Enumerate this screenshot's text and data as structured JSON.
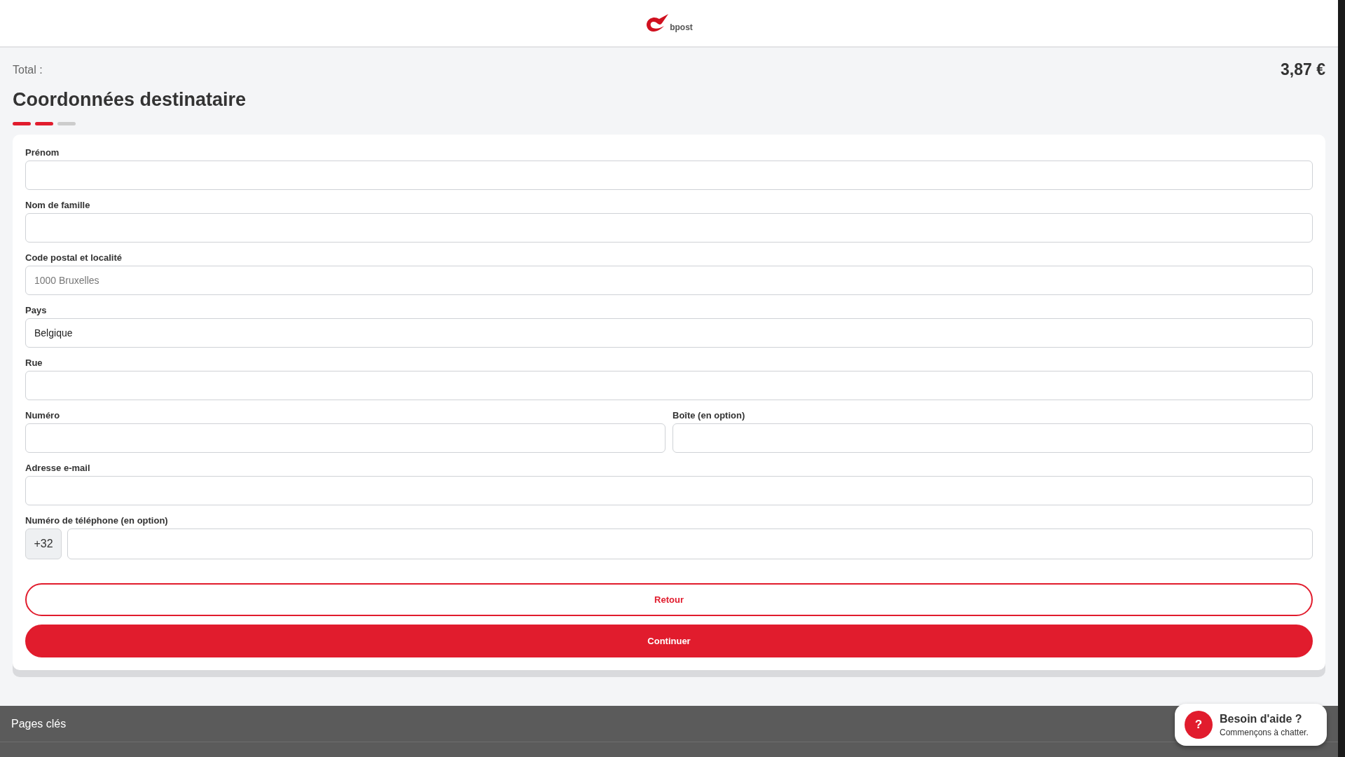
{
  "header": {
    "logo_text": "bpost"
  },
  "total": {
    "label": "Total :",
    "amount": "3,87 €"
  },
  "title": "Coordonnées destinataire",
  "steps": [
    {
      "completed": true
    },
    {
      "completed": true
    },
    {
      "completed": false
    }
  ],
  "fields": [
    {
      "kind": "text",
      "label": "Prénom"
    },
    {
      "kind": "text",
      "label": "Nom de famille"
    },
    {
      "kind": "text",
      "label": "Code postal et localité",
      "placeholder": "1000 Bruxelles"
    },
    {
      "kind": "text",
      "label": "Pays",
      "value": "Belgique"
    },
    {
      "kind": "text",
      "label": "Rue"
    },
    {
      "kind": "row",
      "fields": [
        {
          "kind": "text",
          "label": "Numéro"
        },
        {
          "kind": "text",
          "label": "Boîte (en option)"
        }
      ]
    },
    {
      "kind": "text",
      "label": "Adresse e-mail"
    },
    {
      "kind": "phone",
      "label": "Numéro de téléphone (en option)",
      "prefix": "+32"
    }
  ],
  "buttons": [
    {
      "kind": "outline",
      "label": "Retour"
    },
    {
      "kind": "primary",
      "label": "Continuer"
    }
  ],
  "footer": {
    "title": "Pages clés"
  },
  "chat": {
    "icon": "?",
    "title": "Besoin d'aide ?",
    "subtitle": "Commençons à chatter."
  }
}
